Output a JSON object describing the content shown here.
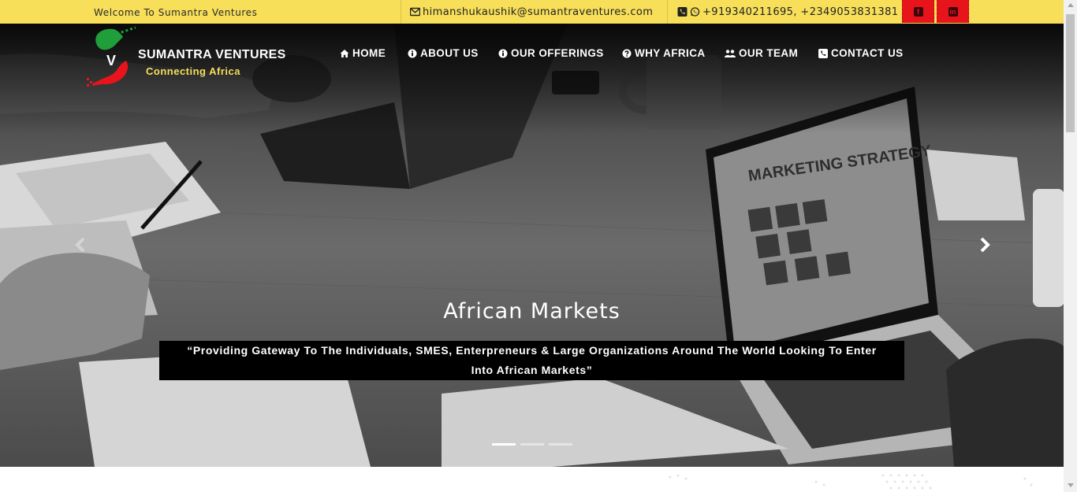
{
  "topbar": {
    "welcome": "Welcome To Sumantra Ventures",
    "email": "himanshukaushik@sumantraventures.com",
    "email_icon": "envelope-icon",
    "phones": "+919340211695, +2349053831381",
    "phone_icons": [
      "phone-icon",
      "whatsapp-icon"
    ],
    "social": [
      {
        "name": "facebook",
        "icon": "facebook-icon"
      },
      {
        "name": "linkedin",
        "icon": "linkedin-icon"
      }
    ],
    "colors": {
      "bar": "#f7df5a",
      "social_bg": "#e8141c"
    }
  },
  "brand": {
    "name": "SUMANTRA VENTURES",
    "tagline": "Connecting Africa",
    "logo_letter": "V",
    "colors": {
      "green": "#1f9e3a",
      "red": "#e8141c",
      "tagline": "#f7df5a"
    }
  },
  "nav": {
    "items": [
      {
        "label": "HOME",
        "icon": "home-icon"
      },
      {
        "label": "ABOUT US",
        "icon": "info-circle-icon"
      },
      {
        "label": "OUR OFFERINGS",
        "icon": "info-circle-icon"
      },
      {
        "label": "WHY AFRICA",
        "icon": "question-circle-icon"
      },
      {
        "label": "OUR TEAM",
        "icon": "users-icon"
      },
      {
        "label": "CONTACT US",
        "icon": "phone-square-icon"
      }
    ]
  },
  "hero": {
    "title": "African Markets",
    "caption": "“Providing Gateway To The Individuals, SMES, Enterpreneurs & Large Organizations Around The World Looking To Enter Into African Markets”",
    "laptop_screen_text": "MARKETING STRATEGY",
    "slides_total": 3,
    "active_slide": 1
  }
}
